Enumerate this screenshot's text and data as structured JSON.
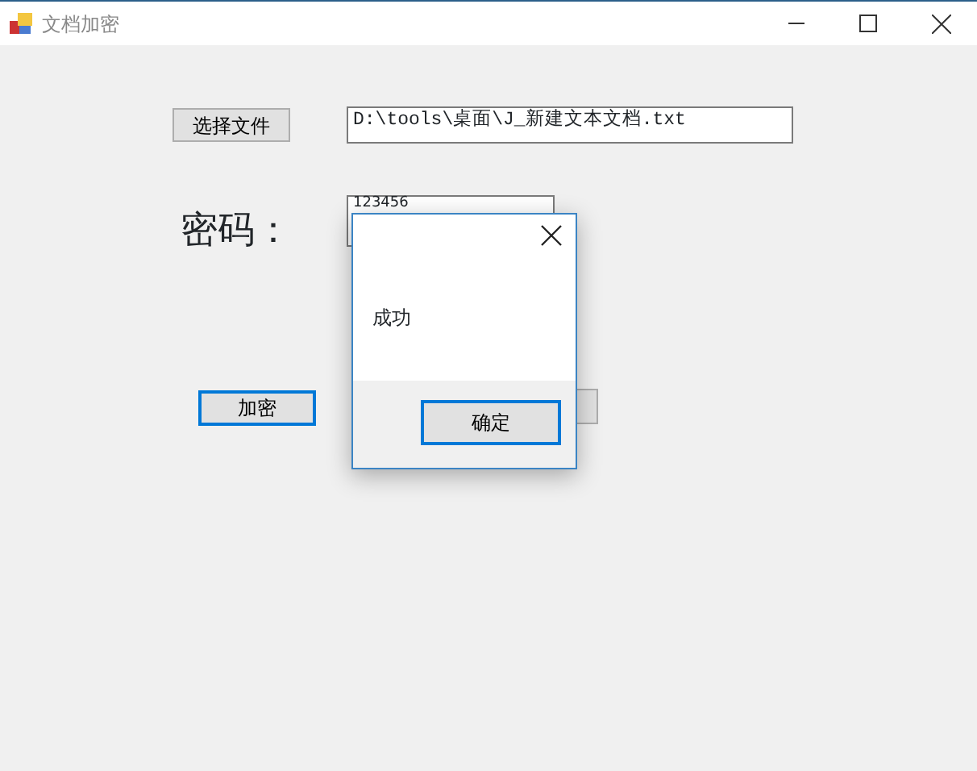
{
  "window": {
    "title": "文档加密"
  },
  "form": {
    "select_button": "选择文件",
    "file_path": "D:\\tools\\桌面\\J_新建文本文档.txt",
    "password_label": "密码：",
    "password": "123456",
    "encrypt_button": "加密"
  },
  "dialog": {
    "message": "成功",
    "ok_button": "确定"
  }
}
